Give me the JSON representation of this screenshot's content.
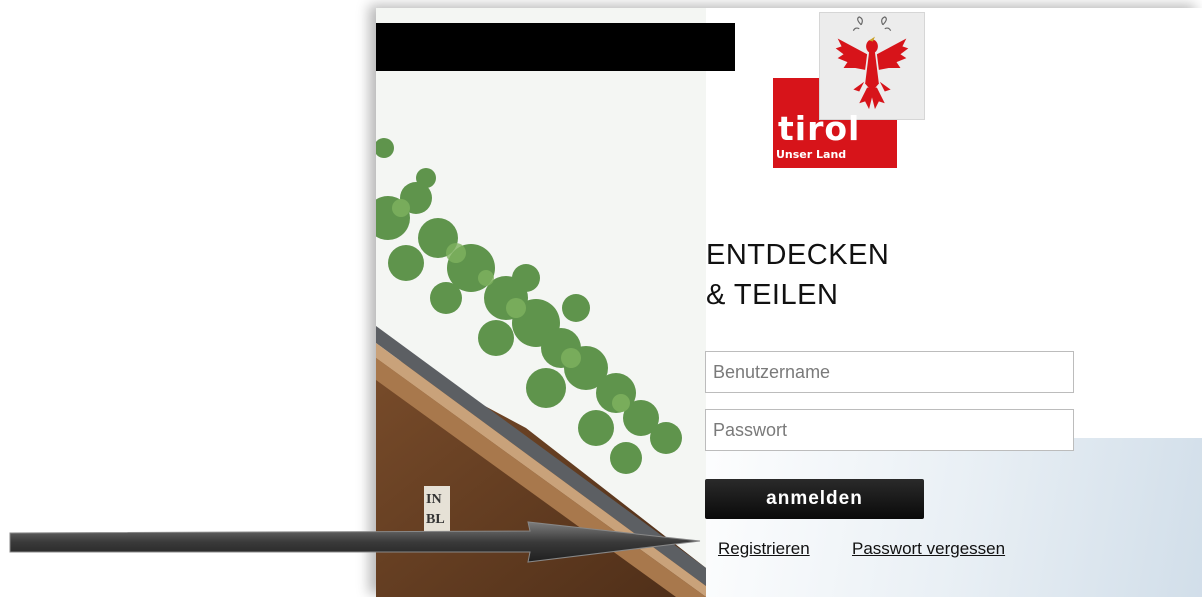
{
  "headline": {
    "line1": "ENTDECKEN",
    "line2": "& TEILEN"
  },
  "logo": {
    "word": "tirol",
    "tagline": "Unser Land"
  },
  "login": {
    "username_placeholder": "Benutzername",
    "password_placeholder": "Passwort",
    "submit_label": "anmelden"
  },
  "links": {
    "register": "Registrieren",
    "forgot_password": "Passwort vergessen"
  },
  "colors": {
    "brand_red": "#d7141a",
    "button": "#111111",
    "bar": "#000000"
  },
  "icons": {
    "eagle": "tirol-eagle-icon",
    "annotation": "pointer-arrow"
  }
}
